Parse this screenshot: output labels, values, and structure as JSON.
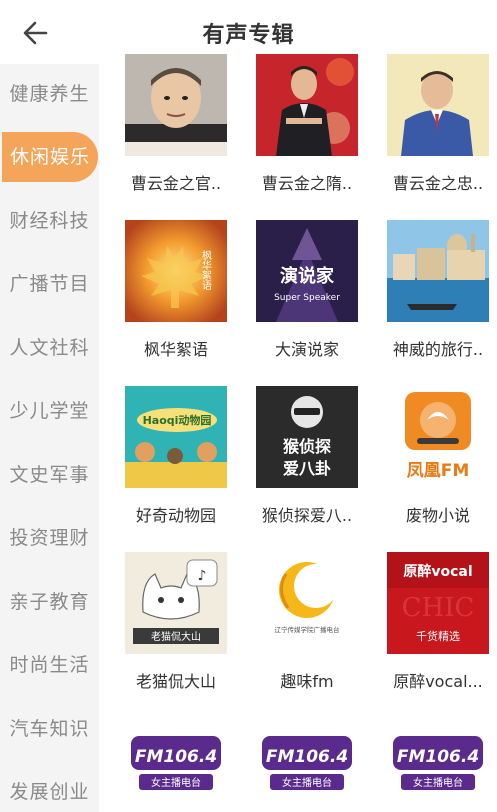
{
  "header": {
    "title": "有声专辑",
    "back_icon": "arrow-left-icon"
  },
  "sidebar": {
    "active_color": "#f5a55a",
    "items": [
      {
        "label": "健康养生"
      },
      {
        "label": "休闲娱乐",
        "active": true
      },
      {
        "label": "财经科技"
      },
      {
        "label": "广播节目"
      },
      {
        "label": "人文社科"
      },
      {
        "label": "少儿学堂"
      },
      {
        "label": "文史军事"
      },
      {
        "label": "投资理财"
      },
      {
        "label": "亲子教育"
      },
      {
        "label": "时尚生活"
      },
      {
        "label": "汽车知识"
      },
      {
        "label": "发展创业"
      }
    ]
  },
  "albums": [
    {
      "title": "曹云金之官.."
    },
    {
      "title": "曹云金之隋.."
    },
    {
      "title": "曹云金之忠.."
    },
    {
      "title": "枫华絮语",
      "cover_text": "枫华絮语"
    },
    {
      "title": "大演说家",
      "cover_text": "演说家",
      "cover_subtext": "Super Speaker"
    },
    {
      "title": "神威的旅行.."
    },
    {
      "title": "好奇动物园",
      "cover_text": "Haoqi动物园"
    },
    {
      "title": "猴侦探爱八..",
      "cover_text": "猴侦探",
      "cover_text2": "爱八卦"
    },
    {
      "title": "废物小说",
      "cover_text": "凤凰FM"
    },
    {
      "title": "老猫侃大山",
      "cover_text": "老猫侃大山"
    },
    {
      "title": "趣味fm",
      "cover_text": "辽宁传媒学院广播电台"
    },
    {
      "title": "原醉vocal...",
      "cover_text": "原醉vocal",
      "cover_subtext": "千货精选"
    },
    {
      "title": "",
      "cover_text": "FM106.4",
      "cover_subtext": "女主播电台"
    },
    {
      "title": "",
      "cover_text": "FM106.4",
      "cover_subtext": "女主播电台"
    },
    {
      "title": "",
      "cover_text": "FM106.4",
      "cover_subtext": "女主播电台"
    }
  ]
}
